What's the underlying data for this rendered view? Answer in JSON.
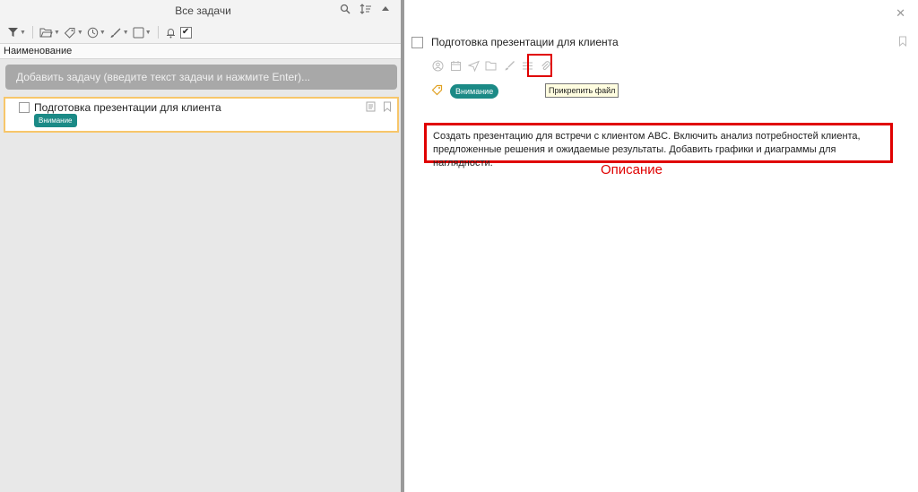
{
  "left": {
    "title": "Все задачи",
    "column_header": "Наименование",
    "add_task_placeholder": "Добавить задачу (введите текст задачи и нажмите Enter)...",
    "tasks": [
      {
        "name": "Подготовка презентации для клиента",
        "tag": "Внимание",
        "tag_color": "#1b8a86",
        "completed": false
      }
    ]
  },
  "details": {
    "title": "Подготовка презентации для клиента",
    "tag": "Внимание",
    "tooltip": "Прикрепить файл",
    "description": "Создать презентацию для встречи с клиентом ABC. Включить анализ потребностей клиента, предложенные решения и ожидаемые результаты. Добавить графики и диаграммы для наглядности.",
    "annotation_label": "Описание",
    "annotation_color": "#e00000"
  },
  "icons": {
    "toolbar": [
      "filter-icon",
      "folder-icon",
      "tag-icon",
      "clock-icon",
      "brush-icon",
      "square-icon",
      "alarm-icon",
      "checkbox-checked-icon"
    ],
    "title_bar": [
      "search-icon",
      "sort-icon",
      "collapse-up-icon"
    ],
    "detail_tools": [
      "user-icon",
      "calendar-icon",
      "send-icon",
      "folder-icon",
      "brush-icon",
      "list-icon",
      "attach-icon"
    ]
  }
}
